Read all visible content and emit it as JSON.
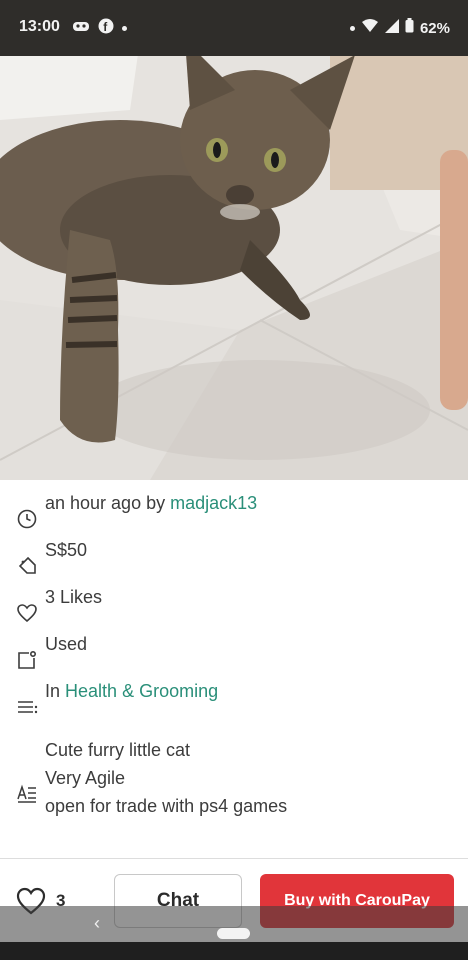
{
  "status_bar": {
    "time": "13:00",
    "battery": "62%",
    "icons": [
      "game-controller-icon",
      "facebook-icon",
      "notification-dot",
      "wifi-icon",
      "signal-icon",
      "battery-icon"
    ]
  },
  "listing": {
    "posted_time": "an hour ago by",
    "seller": "madjack13",
    "price": "S$50",
    "likes": "3 Likes",
    "condition": "Used",
    "category_prefix": "In",
    "category": "Health & Grooming",
    "description_lines": [
      "Cute furry little cat",
      "Very Agile",
      "open for trade with ps4 games"
    ]
  },
  "bottom_bar": {
    "like_count": "3",
    "chat_label": "Chat",
    "buy_label": "Buy with CarouPay"
  },
  "colors": {
    "link": "#2a8f79",
    "buy_button": "#e1353a",
    "status_bar": "#2f2d2a"
  }
}
